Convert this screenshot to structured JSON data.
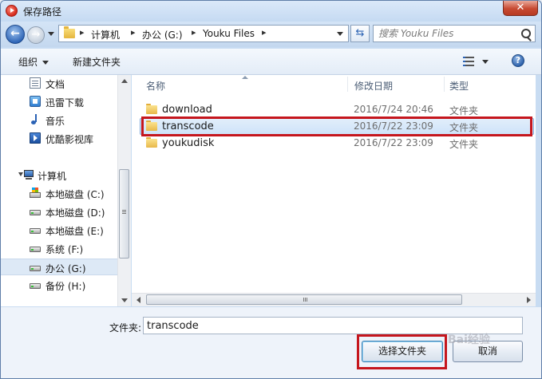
{
  "window": {
    "title": "保存路径",
    "close_glyph": "✕"
  },
  "address": {
    "crumbs": [
      "计算机",
      "办公 (G:)",
      "Youku Files"
    ],
    "separator": "▸"
  },
  "search": {
    "placeholder": "搜索 Youku Files"
  },
  "toolbar": {
    "organize": "组织",
    "new_folder": "新建文件夹",
    "help_glyph": "?"
  },
  "nav": {
    "favorites": [
      "文档",
      "迅雷下载",
      "音乐",
      "优酷影视库"
    ],
    "computer": "计算机",
    "drives": [
      "本地磁盘 (C:)",
      "本地磁盘 (D:)",
      "本地磁盘 (E:)",
      "系统 (F:)",
      "办公 (G:)",
      "备份 (H:)"
    ],
    "selected_drive": "办公 (G:)"
  },
  "columns": {
    "name": "名称",
    "date": "修改日期",
    "type": "类型"
  },
  "files": [
    {
      "name": "download",
      "date": "2016/7/24 20:46",
      "type": "文件夹"
    },
    {
      "name": "transcode",
      "date": "2016/7/22 23:09",
      "type": "文件夹"
    },
    {
      "name": "youkudisk",
      "date": "2016/7/22 23:09",
      "type": "文件夹"
    }
  ],
  "selected_file": "transcode",
  "footer": {
    "folder_label": "文件夹:",
    "folder_value": "transcode",
    "select_button": "选择文件夹",
    "cancel_button": "取消"
  },
  "watermark": "Bai经验",
  "colors": {
    "highlight": "#c5161d",
    "selection": "#cfe3f9"
  }
}
